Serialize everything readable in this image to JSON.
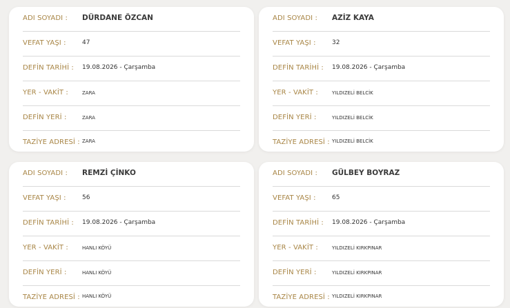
{
  "labels": {
    "name": "ADI SOYADI :",
    "age": "VEFAT YAŞI :",
    "date": "DEFİN TARİHİ :",
    "place_time": "YER - VAKİT :",
    "burial_place": "DEFİN YERİ :",
    "condolence": "TAZİYE ADRESİ :"
  },
  "cards": [
    {
      "name": "DÜRDANE ÖZCAN",
      "age": "47",
      "date": "19.08.2026 - Çarşamba",
      "place_time": "ZARA",
      "burial_place": "ZARA",
      "condolence": "ZARA"
    },
    {
      "name": "AZİZ KAYA",
      "age": "32",
      "date": "19.08.2026 - Çarşamba",
      "place_time": "YILDIZELİ BELCİK",
      "burial_place": "YILDIZELİ BELCİK",
      "condolence": "YILDIZELİ BELCİK"
    },
    {
      "name": "REMZİ ÇİNKO",
      "age": "56",
      "date": "19.08.2026 - Çarşamba",
      "place_time": "HANLI KÖYÜ",
      "burial_place": "HANLI KÖYÜ",
      "condolence": "HANLI KÖYÜ"
    },
    {
      "name": "GÜLBEY BOYRAZ",
      "age": "65",
      "date": "19.08.2026 - Çarşamba",
      "place_time": "YILDIZELİ KIRKPINAR",
      "burial_place": "YILDIZELİ KIRKPINAR",
      "condolence": "YILDIZELİ KIRKPINAR"
    }
  ]
}
